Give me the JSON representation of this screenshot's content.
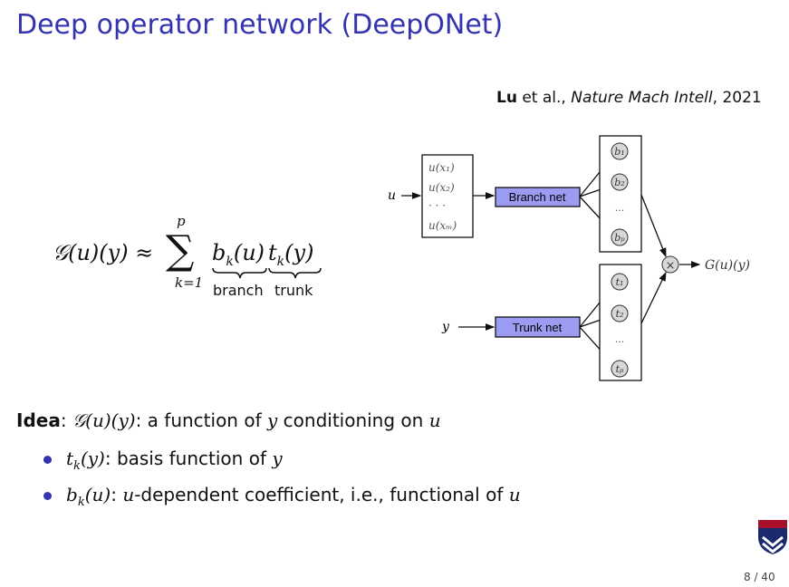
{
  "title": "Deep operator network (DeepONet)",
  "citation": {
    "author": "Lu",
    "rest": " et al., ",
    "journal": "Nature Mach Intell",
    "year": ", 2021"
  },
  "formula": {
    "lhs": "𝒢(u)(y) ≈",
    "sum": "∑",
    "upper": "p",
    "lower": "k=1",
    "branch_term": "b",
    "branch_sub": "k",
    "branch_arg": "(u)",
    "trunk_term": "t",
    "trunk_sub": "k",
    "trunk_arg": "(y)",
    "branch_label": "branch",
    "trunk_label": "trunk"
  },
  "diagram": {
    "input_u": "u",
    "inputs": [
      "u(x₁)",
      "u(x₂)",
      "· · ·",
      "u(xₘ)"
    ],
    "branch_net": "Branch net",
    "trunk_net": "Trunk net",
    "input_y": "y",
    "b_nodes": [
      "b₁",
      "b₂",
      "bₚ"
    ],
    "t_nodes": [
      "t₁",
      "t₂",
      "tₚ"
    ],
    "ellipsis": "···",
    "multiply": "×",
    "output": "G(u)(y)"
  },
  "idea": {
    "label": "Idea",
    "text_math": "𝒢(u)(y)",
    "text": ": a function of ",
    "y": "y",
    "text2": " conditioning on ",
    "u": "u"
  },
  "bullets": [
    {
      "math": "t",
      "sub": "k",
      "arg": "(y)",
      "text": ": basis function of ",
      "var": "y"
    },
    {
      "math": "b",
      "sub": "k",
      "arg": "(u)",
      "text": ": ",
      "var": "u",
      "text2": "-dependent coefficient, i.e., functional of ",
      "var2": "u"
    }
  ],
  "page": "8 / 40",
  "colors": {
    "title": "#3434b0",
    "net_box": "#9b9bf2",
    "node": "#d8d8d8"
  }
}
